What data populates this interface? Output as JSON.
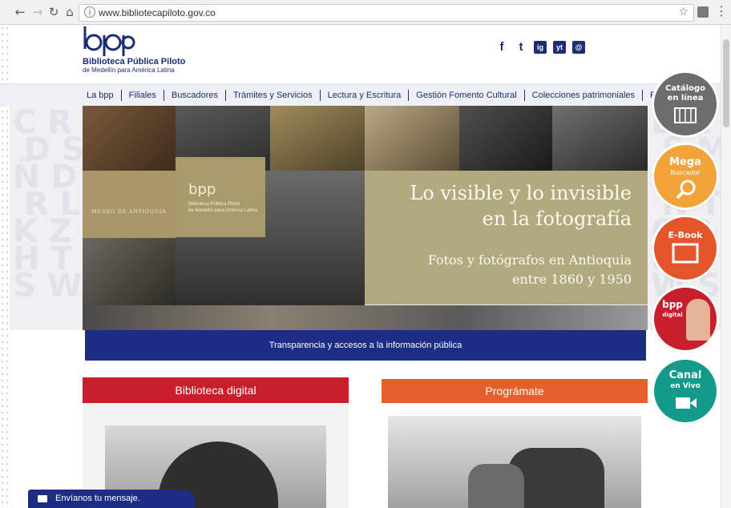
{
  "browser": {
    "url": "www.bibliotecapiloto.gov.co",
    "back_icon": "arrow-left-icon",
    "forward_icon": "arrow-right-icon",
    "reload_icon": "reload-icon",
    "home_icon": "home-icon",
    "info_icon": "info-icon",
    "bookmark_icon": "star-icon",
    "menu_icon": "kebab-menu-icon"
  },
  "header": {
    "logo_mark": "bpp",
    "logo_name": "Biblioteca Pública Piloto",
    "logo_sub": "de Medellín para América Latina",
    "social": [
      "facebook-icon",
      "twitter-icon",
      "instagram-icon",
      "youtube-icon",
      "email-icon"
    ],
    "social_glyphs": [
      "f",
      "t",
      "ig",
      "yt",
      "@"
    ]
  },
  "nav": {
    "items": [
      "La bpp",
      "Filiales",
      "Buscadores",
      "Trámites y Servicios",
      "Lectura y Escritura",
      "Gestión Fomento Cultural",
      "Colecciones patrimoniales",
      "PQRS"
    ]
  },
  "hero": {
    "title": "Lo visible y lo invisible\nen la fotografía",
    "subtitle": "Fotos y fotógrafos en Antioquia\nentre 1860 y 1950",
    "museo_caption": "MUSEO DE ANTIOQUIA",
    "mini_logo": "bpp",
    "mini_name": "Biblioteca Pública Piloto",
    "mini_sub": "de Medellín para América Latina",
    "colors": {
      "panel": "#b1aa80"
    }
  },
  "transparency": {
    "label": "Transparencia y accesos a la información pública"
  },
  "sections": {
    "left_title": "Biblioteca digital",
    "right_title": "Prográmate"
  },
  "side_buttons": [
    {
      "line1": "Catálogo",
      "line2": "en línea",
      "color": "#6d6d6d",
      "icon": "books-icon"
    },
    {
      "line1": "Mega",
      "line2": "Buscador",
      "color": "#f2a43a",
      "icon": "magnifier-icon"
    },
    {
      "line1": "E-Book",
      "line2": "",
      "color": "#e4552b",
      "icon": "ebook-icon"
    },
    {
      "line1": "bpp",
      "line2": "digital",
      "color": "#c71f2c",
      "icon": "digital-reader-icon"
    },
    {
      "line1": "Canal",
      "line2": "en Vivo",
      "color": "#139a8a",
      "icon": "video-camera-icon"
    }
  ],
  "chat": {
    "label": "Envíanos tu mensaje."
  },
  "colors": {
    "brand_blue": "#1d2d73",
    "red": "#c71f2c",
    "orange": "#e45f2b"
  }
}
